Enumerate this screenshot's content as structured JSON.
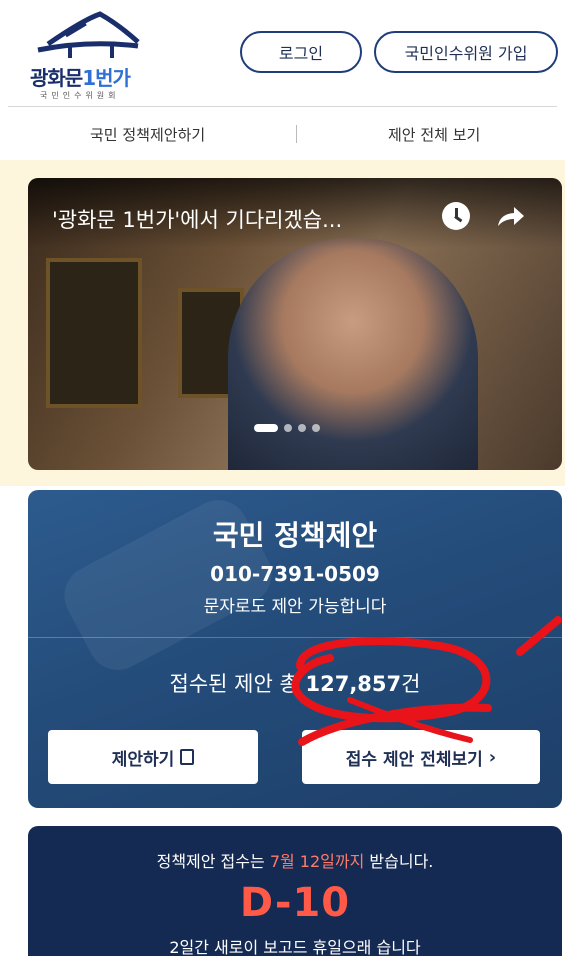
{
  "header": {
    "logo": {
      "title_main": "광화문",
      "title_num": "1번가",
      "subtitle": "국민인수위원회"
    },
    "login_label": "로그인",
    "join_label": "국민인수위원 가입"
  },
  "subnav": {
    "items": [
      {
        "label": "국민 정책제안하기"
      },
      {
        "label": "제안 전체 보기"
      }
    ]
  },
  "hero": {
    "video_title": "'광화문 1번가'에서 기다리겠습...",
    "icons": [
      "clock-icon",
      "share-icon"
    ],
    "slides": {
      "count": 4,
      "active": 1
    }
  },
  "proposal": {
    "title": "국민 정책제안",
    "phone": "010-7391-0509",
    "sms_note": "문자로도 제안 가능합니다",
    "count_prefix": "접수된 제안 총 ",
    "count_value": "127,857",
    "count_suffix": "건",
    "button_propose": "제안하기",
    "button_view_all": "접수 제안 전체보기"
  },
  "dday": {
    "notice_prefix": "정책제안 접수는 ",
    "notice_highlight": "7월 12일까지",
    "notice_suffix": " 받습니다.",
    "count": "D-10",
    "footer_partial": "2일간 새로이 보고드 휴일으래 습니다"
  },
  "colors": {
    "brand_navy": "#1f3d7a",
    "proposal_bg": "#244c7a",
    "dday_bg": "#152a52",
    "dday_accent": "#ff5a48",
    "hero_bg": "#fdf6dd",
    "annotation_red": "#e8141a"
  }
}
